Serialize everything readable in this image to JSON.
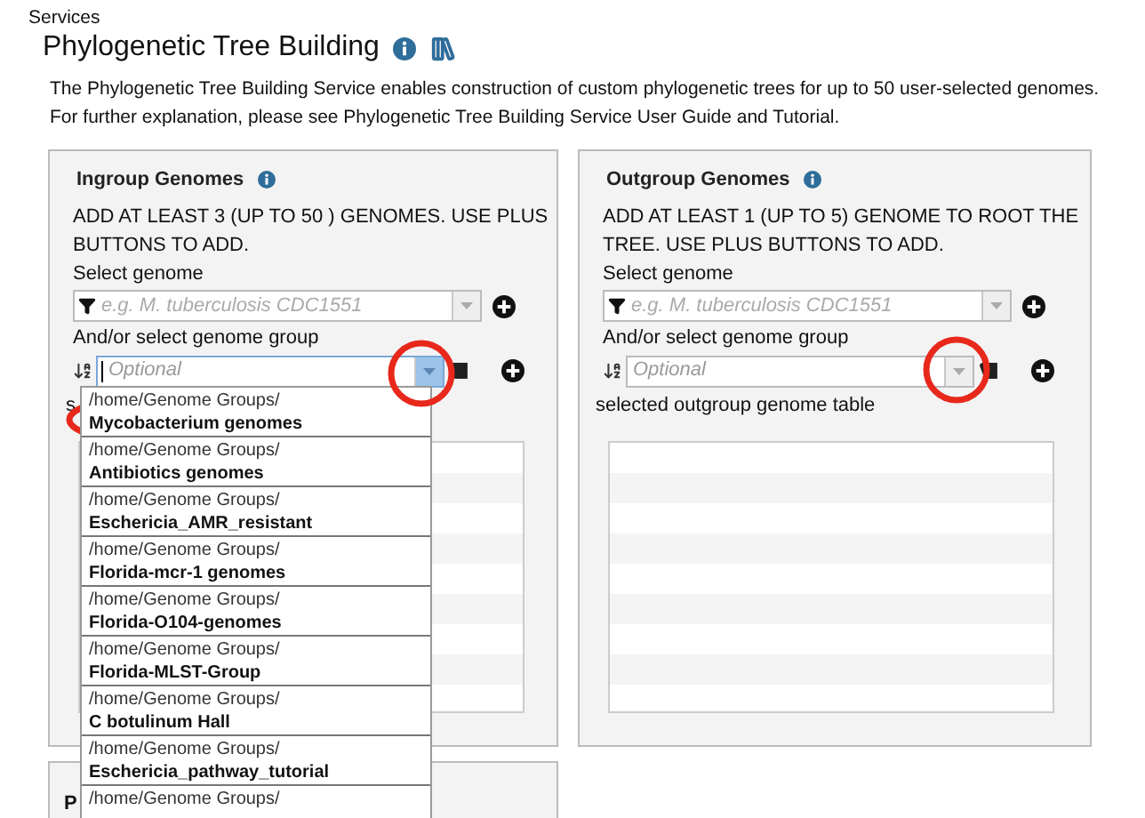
{
  "breadcrumb": "Services",
  "page": {
    "title": "Phylogenetic Tree Building",
    "description": [
      "The Phylogenetic Tree Building Service enables construction of custom phylogenetic trees for up to 50 user-selected genomes.",
      "For further explanation, please see Phylogenetic Tree Building Service User Guide and Tutorial."
    ]
  },
  "panels": [
    {
      "title": "Ingroup Genomes",
      "instructions": "ADD AT LEAST 3 (UP TO 50 ) GENOMES. USE PLUS BUTTONS TO ADD.",
      "genome_label": "Select genome",
      "genome_placeholder": "e.g. M. tuberculosis CDC1551",
      "group_label": "And/or select genome group",
      "group_placeholder": "Optional",
      "dropdown_open": true,
      "table_label": "s"
    },
    {
      "title": "Outgroup Genomes",
      "instructions": "ADD AT LEAST 1 (UP TO 5) GENOME TO ROOT THE TREE. USE PLUS BUTTONS TO ADD.",
      "genome_label": "Select genome",
      "genome_placeholder": "e.g. M. tuberculosis CDC1551",
      "group_label": "And/or select genome group",
      "group_placeholder": "Optional",
      "dropdown_open": false,
      "table_label": "selected outgroup genome table"
    }
  ],
  "dropdown": {
    "items": [
      {
        "path": "/home/Genome Groups/",
        "name": "Mycobacterium genomes"
      },
      {
        "path": "/home/Genome Groups/",
        "name": "Antibiotics genomes"
      },
      {
        "path": "/home/Genome Groups/",
        "name": "Eschericia_AMR_resistant"
      },
      {
        "path": "/home/Genome Groups/",
        "name": "Florida-mcr-1 genomes"
      },
      {
        "path": "/home/Genome Groups/",
        "name": "Florida-O104-genomes"
      },
      {
        "path": "/home/Genome Groups/",
        "name": "Florida-MLST-Group"
      },
      {
        "path": "/home/Genome Groups/",
        "name": "C botulinum Hall"
      },
      {
        "path": "/home/Genome Groups/",
        "name": "Eschericia_pathway_tutorial"
      },
      {
        "path": "/home/Genome Groups/"
      }
    ]
  },
  "lower_panel": {
    "title": "P"
  }
}
